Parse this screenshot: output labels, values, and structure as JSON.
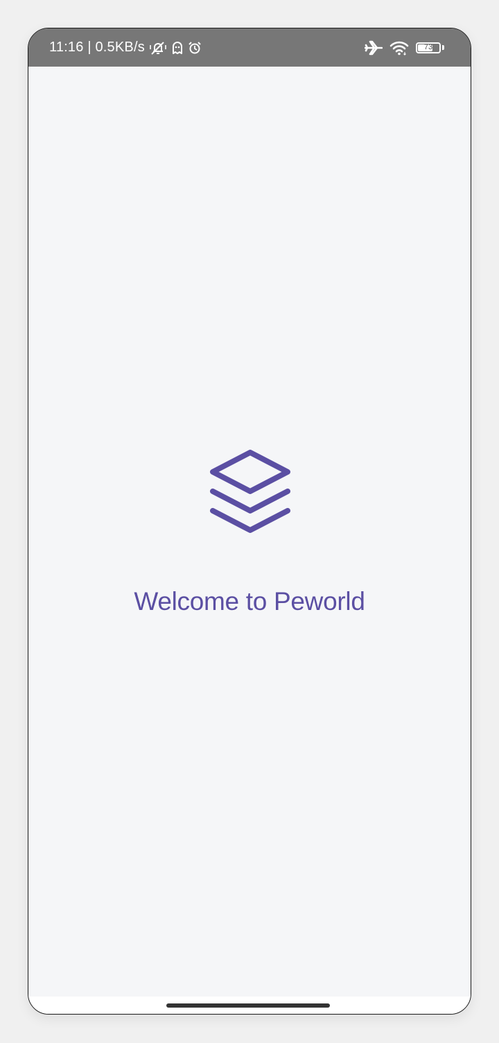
{
  "status_bar": {
    "time_speed": "11:16 | 0.5KB/s",
    "icons": [
      "mute-vibrate-icon",
      "ghost-icon",
      "alarm-icon",
      "airplane-icon",
      "wifi-icon",
      "battery-icon"
    ],
    "battery_level": "73",
    "background": "#777777"
  },
  "splash": {
    "logo_icon": "stacked-layers-icon",
    "welcome_text": "Welcome to Peworld",
    "brand_color": "#5b4fa3",
    "background": "#f5f6f8"
  }
}
